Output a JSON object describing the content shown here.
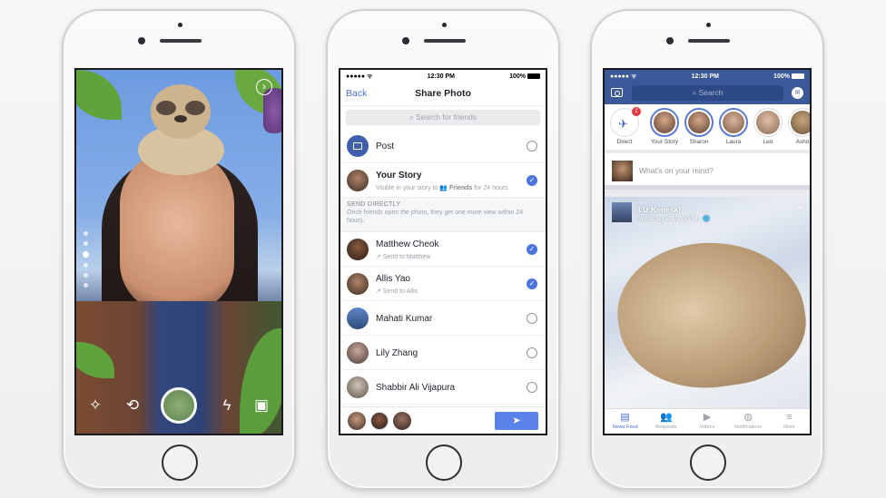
{
  "camera_phone": {
    "tools": {
      "effects_icon": "magic-wand-icon",
      "flip_camera_icon": "camera-flip-icon",
      "flash_icon": "flash-off-icon",
      "gallery_icon": "gallery-icon",
      "next_icon": "chevron-right-circle-icon"
    },
    "glyphs": {
      "effects": "✧",
      "flip": "⟲",
      "flash": "ϟ",
      "gallery": "▣",
      "next": "›"
    },
    "filter": "sloth mask",
    "zoom_level_index": 3,
    "zoom_level_count": 6
  },
  "share_phone": {
    "status": {
      "signal": "●●●●● ᯤ",
      "time": "12:30 PM",
      "battery": "100%"
    },
    "nav": {
      "back": "Back",
      "title": "Share Photo"
    },
    "search_placeholder": "Search for friends",
    "post": {
      "label": "Post",
      "checked": false
    },
    "your_story": {
      "label": "Your Story",
      "sub_prefix": "Visible in your story to",
      "audience": "Friends",
      "sub_suffix": "for 24 hours",
      "checked": true
    },
    "send_directly": {
      "heading": "SEND DIRECTLY",
      "description": "Once friends open the photo, they get one more view within 24 hours."
    },
    "friends": [
      {
        "name": "Matthew Cheok",
        "sub": "Send to Matthew",
        "checked": true
      },
      {
        "name": "Allis Yao",
        "sub": "Send to Allis",
        "checked": true
      },
      {
        "name": "Mahati Kumar",
        "sub": "",
        "checked": false
      },
      {
        "name": "Lily Zhang",
        "sub": "",
        "checked": false
      },
      {
        "name": "Shabbir Ali Vijapura",
        "sub": "",
        "checked": false
      }
    ],
    "selected_count": 3,
    "send_glyph": "➤",
    "check_glyph": "✓",
    "arrow_glyph": "↗"
  },
  "feed_phone": {
    "status": {
      "signal": "●●●●● ᯤ",
      "time": "12:30 PM",
      "battery": "100%"
    },
    "search_label": "Search",
    "messenger_glyph": "✉",
    "stories": [
      {
        "label": "Direct",
        "badge": "2"
      },
      {
        "label": "Your Story"
      },
      {
        "label": "Sharon"
      },
      {
        "label": "Laura"
      },
      {
        "label": "Leo"
      },
      {
        "label": "Asho"
      }
    ],
    "direct_glyph": "✈",
    "composer_placeholder": "What's on your mind?",
    "post": {
      "author": "Liz Keneski",
      "time": "Yesterday at 10:14 PM · 🌐",
      "chevron": "⌄"
    },
    "tabs": [
      {
        "label": "News Feed",
        "glyph": "▤",
        "active": true
      },
      {
        "label": "Requests",
        "glyph": "👥",
        "active": false
      },
      {
        "label": "Videos",
        "glyph": "▶",
        "active": false
      },
      {
        "label": "Notifications",
        "glyph": "◍",
        "active": false
      },
      {
        "label": "More",
        "glyph": "≡",
        "active": false
      }
    ]
  },
  "colors": {
    "facebook_blue": "#3b5998",
    "accent_blue": "#4b74dc",
    "send_blue": "#5b82e8",
    "badge_red": "#e0393e"
  }
}
